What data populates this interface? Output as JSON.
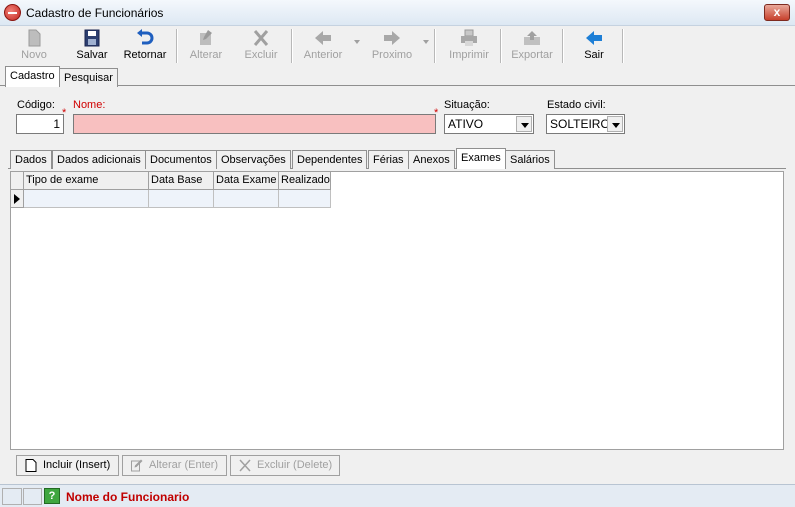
{
  "window": {
    "title": "Cadastro de Funcionários",
    "close_label": "x"
  },
  "toolbar": {
    "novo": "Novo",
    "salvar": "Salvar",
    "retornar": "Retornar",
    "alterar": "Alterar",
    "excluir": "Excluir",
    "anterior": "Anterior",
    "proximo": "Proximo",
    "imprimir": "Imprimir",
    "exportar": "Exportar",
    "sair": "Sair"
  },
  "main_tabs": [
    "Cadastro",
    "Pesquisar"
  ],
  "form": {
    "codigo_label": "Código:",
    "codigo_value": "1",
    "nome_label": "Nome:",
    "nome_value": "",
    "situacao_label": "Situação:",
    "situacao_value": "ATIVO",
    "estado_civil_label": "Estado civil:",
    "estado_civil_value": "SOLTEIRO"
  },
  "sub_tabs": [
    "Dados",
    "Dados adicionais",
    "Documentos",
    "Observações",
    "Dependentes",
    "Férias",
    "Anexos",
    "Exames",
    "Salários"
  ],
  "grid": {
    "columns": [
      "Tipo de exame",
      "Data Base",
      "Data Exame",
      "Realizado"
    ]
  },
  "buttons": {
    "incluir": "Incluir (Insert)",
    "alterar": "Alterar (Enter)",
    "excluir": "Excluir (Delete)"
  },
  "statusbar": {
    "text": "Nome do Funcionario",
    "help_icon": "?"
  },
  "colors": {
    "required": "#d00000",
    "name_field_bg": "#f8c0c0",
    "grid_row_bg": "#eef3fa",
    "status_text": "#c00000"
  }
}
